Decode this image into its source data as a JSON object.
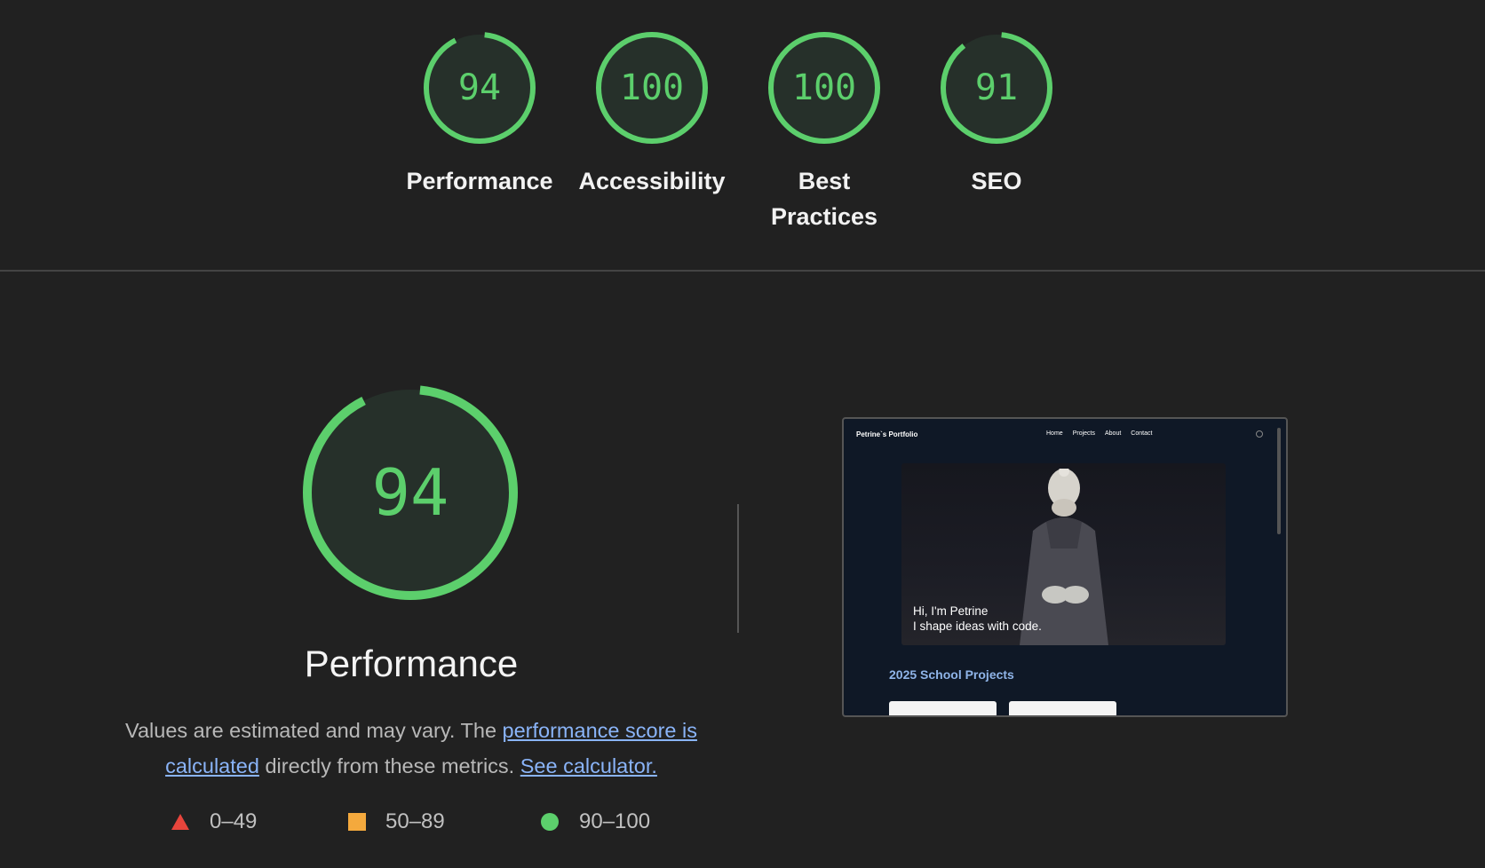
{
  "categories": [
    {
      "label": "Performance",
      "score": "94",
      "fraction": 0.94
    },
    {
      "label": "Accessibility",
      "score": "100",
      "fraction": 1.0
    },
    {
      "label": "Best Practices",
      "score": "100",
      "fraction": 1.0
    },
    {
      "label": "SEO",
      "score": "91",
      "fraction": 0.91
    }
  ],
  "performance": {
    "score": "94",
    "fraction": 0.94,
    "title": "Performance",
    "desc_part1": "Values are estimated and may vary. The ",
    "link_score": "performance score is calculated",
    "desc_part2": " directly from these metrics. ",
    "link_calc": "See calculator."
  },
  "legend": [
    {
      "range": "0–49",
      "shape": "triangle",
      "color": "#e8453c"
    },
    {
      "range": "50–89",
      "shape": "square",
      "color": "#f4a93d"
    },
    {
      "range": "90–100",
      "shape": "circle",
      "color": "#5ccf6c"
    }
  ],
  "colors": {
    "pass": "#5ccf6c",
    "gauge_fill": "#26302a"
  },
  "screenshot": {
    "brand": "Petrine`s Portfolio",
    "nav": [
      "Home",
      "Projects",
      "About",
      "Contact"
    ],
    "hero_line1": "Hi, I'm Petrine",
    "hero_line2": "I shape ideas with code.",
    "section_title": "2025 School Projects"
  }
}
